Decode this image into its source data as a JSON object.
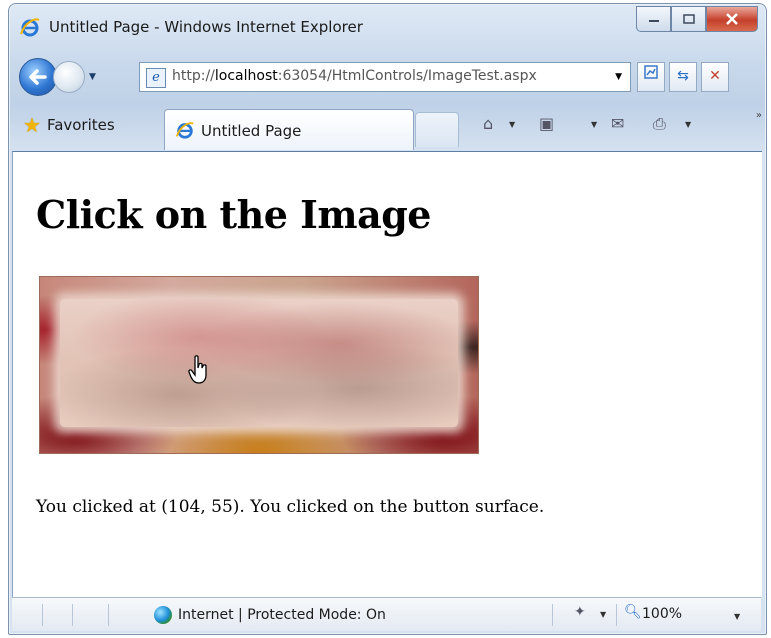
{
  "window": {
    "title": "Untitled Page - Windows Internet Explorer"
  },
  "address_bar": {
    "url_prefix": "http://",
    "url_host": "localhost",
    "url_rest": ":63054/HtmlControls/ImageTest.aspx"
  },
  "tabs": {
    "favorites_label": "Favorites",
    "active_tab_label": "Untitled Page"
  },
  "page": {
    "heading": "Click on the Image",
    "message": "You clicked at (104, 55). You clicked on the button surface."
  },
  "status_bar": {
    "zone_text": "Internet | Protected Mode: On",
    "zoom": "100%"
  },
  "colors": {
    "accent": "#2f77d3",
    "close_button": "#c5402b"
  }
}
